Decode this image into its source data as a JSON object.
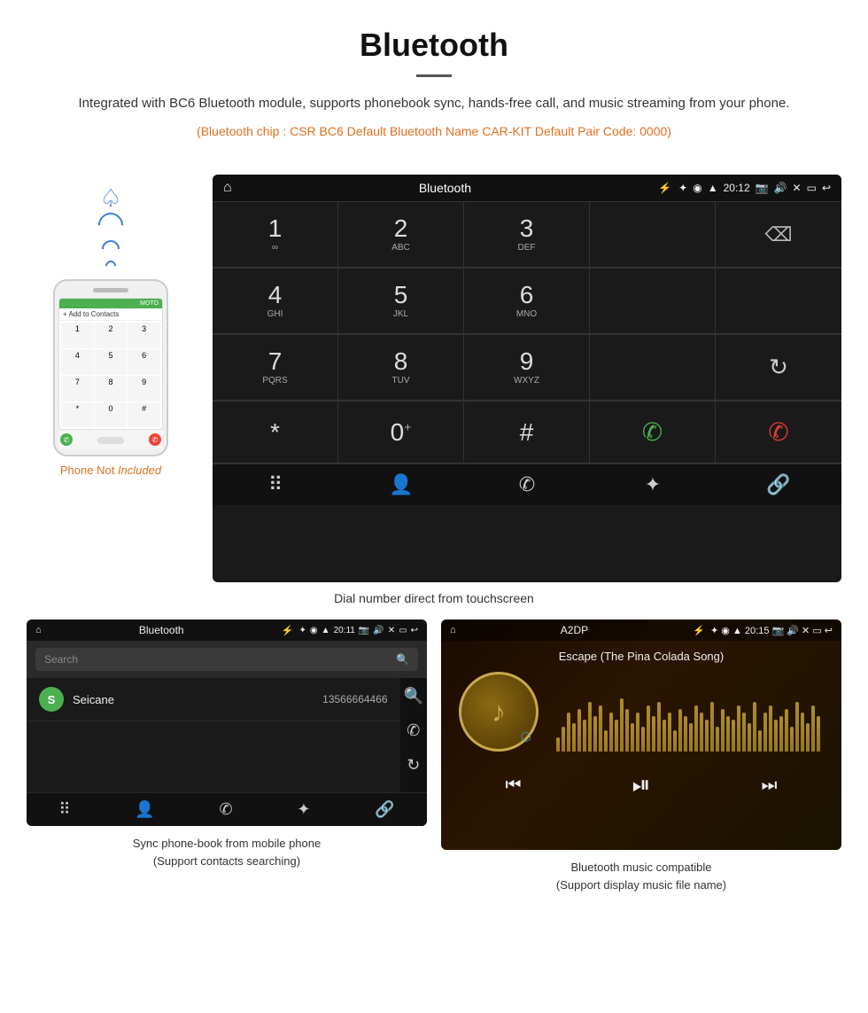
{
  "header": {
    "title": "Bluetooth",
    "description": "Integrated with BC6 Bluetooth module, supports phonebook sync, hands-free call, and music streaming from your phone.",
    "specs": "(Bluetooth chip : CSR BC6    Default Bluetooth Name CAR-KIT    Default Pair Code: 0000)"
  },
  "phone_label": "Phone Not Included",
  "car_screen": {
    "statusbar": {
      "title": "Bluetooth",
      "time": "20:12"
    },
    "dialpad": {
      "keys": [
        {
          "num": "1",
          "sub": ""
        },
        {
          "num": "2",
          "sub": "ABC"
        },
        {
          "num": "3",
          "sub": "DEF"
        },
        {
          "num": "",
          "sub": ""
        },
        {
          "num": "",
          "sub": "backspace"
        },
        {
          "num": "4",
          "sub": "GHI"
        },
        {
          "num": "5",
          "sub": "JKL"
        },
        {
          "num": "6",
          "sub": "MNO"
        },
        {
          "num": "",
          "sub": ""
        },
        {
          "num": "",
          "sub": ""
        },
        {
          "num": "7",
          "sub": "PQRS"
        },
        {
          "num": "8",
          "sub": "TUV"
        },
        {
          "num": "9",
          "sub": "WXYZ"
        },
        {
          "num": "",
          "sub": ""
        },
        {
          "num": "",
          "sub": "refresh"
        },
        {
          "num": "*",
          "sub": ""
        },
        {
          "num": "0",
          "sub": "+"
        },
        {
          "num": "#",
          "sub": ""
        },
        {
          "num": "",
          "sub": "call"
        },
        {
          "num": "",
          "sub": "end"
        }
      ]
    },
    "bottom_nav": [
      "grid",
      "person",
      "phone",
      "bluetooth",
      "link"
    ]
  },
  "dial_caption": "Dial number direct from touchscreen",
  "phonebook_screen": {
    "statusbar_title": "Bluetooth",
    "statusbar_time": "20:11",
    "search_placeholder": "Search",
    "contact": {
      "initial": "S",
      "name": "Seicane",
      "number": "13566664466"
    }
  },
  "phonebook_caption": "Sync phone-book from mobile phone\n(Support contacts searching)",
  "music_screen": {
    "statusbar_title": "A2DP",
    "statusbar_time": "20:15",
    "song_title": "Escape (The Pina Colada Song)"
  },
  "music_caption": "Bluetooth music compatible\n(Support display music file name)",
  "vis_bars": [
    20,
    35,
    55,
    40,
    60,
    45,
    70,
    50,
    65,
    30,
    55,
    45,
    75,
    60,
    40,
    55,
    35,
    65,
    50,
    70,
    45,
    55,
    30,
    60,
    50,
    40,
    65,
    55,
    45,
    70,
    35,
    60,
    50,
    45,
    65,
    55,
    40,
    70,
    30,
    55,
    65,
    45,
    50,
    60,
    35,
    70,
    55,
    40,
    65,
    50
  ]
}
